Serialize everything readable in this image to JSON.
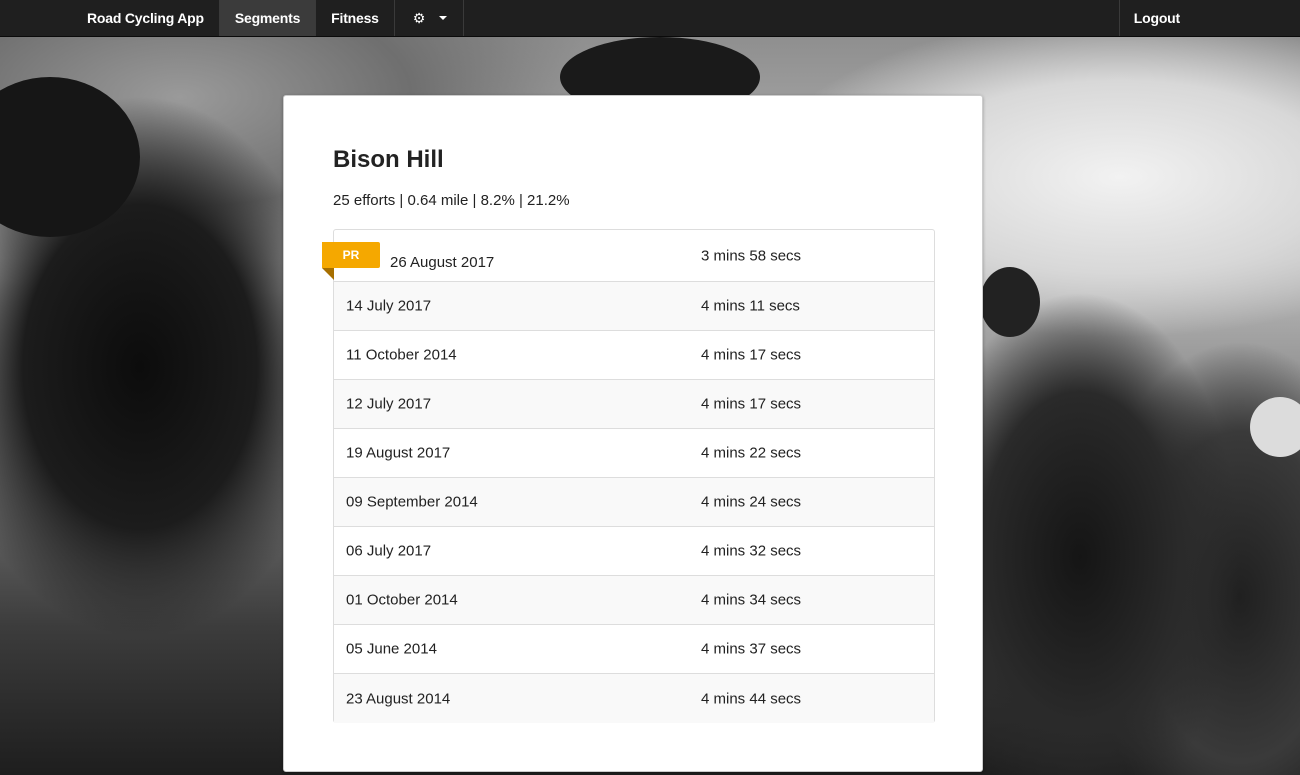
{
  "nav": {
    "brand": "Road Cycling App",
    "items": [
      {
        "label": "Segments",
        "active": true
      },
      {
        "label": "Fitness",
        "active": false
      }
    ],
    "settings_icon": "gear-icon",
    "logout": "Logout"
  },
  "segment": {
    "name": "Bison Hill",
    "stats": "25 efforts | 0.64 mile | 8.2% | 21.2%",
    "pr_label": "PR",
    "pr_color": "#f5a800",
    "efforts": [
      {
        "date": "26 August 2017",
        "time": "3 mins 58 secs"
      },
      {
        "date": "14 July 2017",
        "time": "4 mins 11 secs"
      },
      {
        "date": "11 October 2014",
        "time": "4 mins 17 secs"
      },
      {
        "date": "12 July 2017",
        "time": "4 mins 17 secs"
      },
      {
        "date": "19 August 2017",
        "time": "4 mins 22 secs"
      },
      {
        "date": "09 September 2014",
        "time": "4 mins 24 secs"
      },
      {
        "date": "06 July 2017",
        "time": "4 mins 32 secs"
      },
      {
        "date": "01 October 2014",
        "time": "4 mins 34 secs"
      },
      {
        "date": "05 June 2014",
        "time": "4 mins 37 secs"
      },
      {
        "date": "23 August 2014",
        "time": "4 mins 44 secs"
      }
    ]
  }
}
